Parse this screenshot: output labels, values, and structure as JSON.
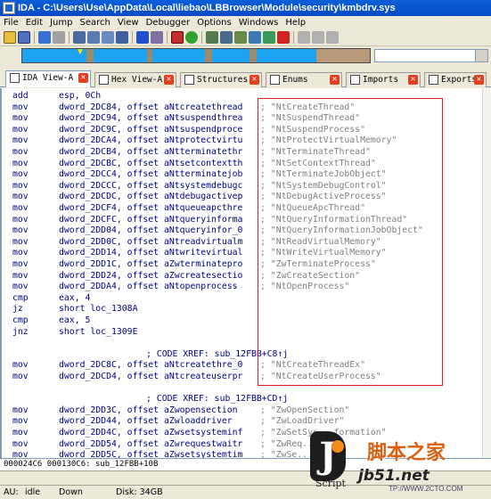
{
  "window": {
    "title": "IDA - C:\\Users\\Use\\AppData\\Local\\liebao\\LBBrowser\\Module\\security\\kmbdrv.sys"
  },
  "menu": [
    "File",
    "Edit",
    "Jump",
    "Search",
    "View",
    "Debugger",
    "Options",
    "Windows",
    "Help"
  ],
  "tabs": [
    {
      "label": "IDA View-A",
      "active": true
    },
    {
      "label": "Hex View-A"
    },
    {
      "label": "Structures"
    },
    {
      "label": "Enums"
    },
    {
      "label": "Imports"
    },
    {
      "label": "Exports"
    }
  ],
  "code": [
    {
      "m": "add",
      "o": "esp, 0Ch",
      "c": ""
    },
    {
      "m": "mov",
      "o": "dword_2DC84, offset aNtcreatethread",
      "c": "; \"NtCreateThread\""
    },
    {
      "m": "mov",
      "o": "dword_2DC94, offset aNtsuspendthrea",
      "c": "; \"NtSuspendThread\""
    },
    {
      "m": "mov",
      "o": "dword_2DC9C, offset aNtsuspendproce",
      "c": "; \"NtSuspendProcess\""
    },
    {
      "m": "mov",
      "o": "dword_2DCA4, offset aNtprotectvirtu",
      "c": "; \"NtProtectVirtualMemory\""
    },
    {
      "m": "mov",
      "o": "dword_2DCB4, offset aNtterminatethr",
      "c": "; \"NtTerminateThread\""
    },
    {
      "m": "mov",
      "o": "dword_2DCBC, offset aNtsetcontextth",
      "c": "; \"NtSetContextThread\""
    },
    {
      "m": "mov",
      "o": "dword_2DCC4, offset aNtterminatejob",
      "c": "; \"NtTerminateJobObject\""
    },
    {
      "m": "mov",
      "o": "dword_2DCCC, offset aNtsystemdebugc",
      "c": "; \"NtSystemDebugControl\""
    },
    {
      "m": "mov",
      "o": "dword_2DCDC, offset aNtdebugactivep",
      "c": "; \"NtDebugActiveProcess\""
    },
    {
      "m": "mov",
      "o": "dword_2DCF4, offset aNtqueueapcthre",
      "c": "; \"NtQueueApcThread\""
    },
    {
      "m": "mov",
      "o": "dword_2DCFC, offset aNtqueryinforma",
      "c": "; \"NtQueryInformationThread\""
    },
    {
      "m": "mov",
      "o": "dword_2DD04, offset aNtqueryinfor_0",
      "c": "; \"NtQueryInformationJobObject\""
    },
    {
      "m": "mov",
      "o": "dword_2DD0C, offset aNtreadvirtualm",
      "c": "; \"NtReadVirtualMemory\""
    },
    {
      "m": "mov",
      "o": "dword_2DD14, offset aNtwritevirtual",
      "c": "; \"NtWriteVirtualMemory\""
    },
    {
      "m": "mov",
      "o": "dword_2DD1C, offset aZwterminatepro",
      "c": "; \"ZwTerminateProcess\""
    },
    {
      "m": "mov",
      "o": "dword_2DD24, offset aZwcreatesectio",
      "c": "; \"ZwCreateSection\""
    },
    {
      "m": "mov",
      "o": "dword_2DDA4, offset aNtopenprocess",
      "c": "; \"NtOpenProcess\""
    },
    {
      "m": "cmp",
      "o": "eax, 4",
      "c": ""
    },
    {
      "m": "jz",
      "o": "short loc_1308A",
      "c": ""
    },
    {
      "m": "cmp",
      "o": "eax, 5",
      "c": ""
    },
    {
      "m": "jnz",
      "o": "short loc_1309E",
      "c": ""
    },
    {
      "m": "",
      "o": "",
      "c": ""
    },
    {
      "m": "",
      "o": "",
      "c": "; CODE XREF: sub_12FBB+C8↑j",
      "x": true
    },
    {
      "m": "mov",
      "o": "dword_2DC8C, offset aNtcreatethre_0",
      "c": "; \"NtCreateThreadEx\""
    },
    {
      "m": "mov",
      "o": "dword_2DCD4, offset aNtcreateuserpr",
      "c": "; \"NtCreateUserProcess\""
    },
    {
      "m": "",
      "o": "",
      "c": ""
    },
    {
      "m": "",
      "o": "",
      "c": "; CODE XREF: sub_12FBB+CD↑j",
      "x": true
    },
    {
      "m": "mov",
      "o": "dword_2DD3C, offset aZwopensection",
      "c": "; \"ZwOpenSection\""
    },
    {
      "m": "mov",
      "o": "dword_2DD44, offset aZwloaddriver",
      "c": "; \"ZwLoadDriver\""
    },
    {
      "m": "mov",
      "o": "dword_2DD4C, offset aZwsetsysteminf",
      "c": "; \"ZwSetSys...formation\""
    },
    {
      "m": "mov",
      "o": "dword_2DD54, offset aZwrequestwaitr",
      "c": "; \"ZwReq...\""
    },
    {
      "m": "mov",
      "o": "dword_2DD5C, offset aZwsetsystemtim",
      "c": "; \"ZwSe...\""
    }
  ],
  "statusline": "000024C6 000130C6: sub_12FBB+10B",
  "statusbar": {
    "au": "AU:",
    "state": "idle",
    "dir": "Down",
    "disk": "Disk: 34GB"
  },
  "watermark": {
    "site": "脚本之家",
    "domain": "jb51.net",
    "script": "Script",
    "sub": "TP://WWW.2CTO.COM"
  },
  "colors": {
    "titlebar": "#0548c5",
    "nav_band": "#1ea3f0",
    "highlight_box": "#e02020",
    "code_text": "#000080",
    "comment": "#808080"
  }
}
